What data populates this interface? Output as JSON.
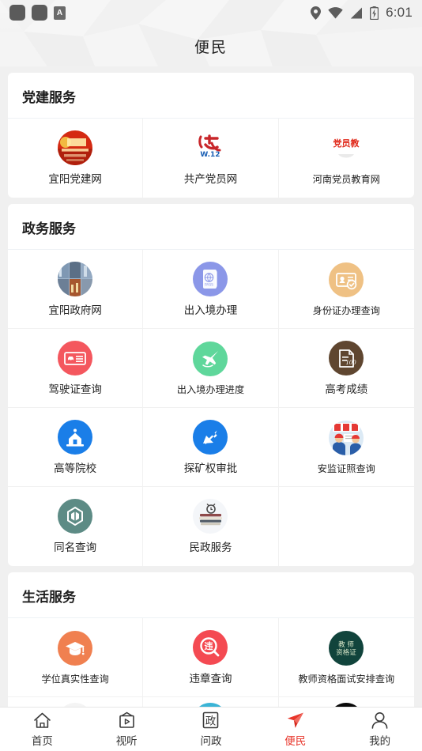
{
  "status_bar": {
    "left_icons": [
      "app-badge-square",
      "app-badge-square",
      "letter-a-badge"
    ],
    "letter_a": "A",
    "right_icons": [
      "location-pin-icon",
      "wifi-icon",
      "signal-icon",
      "battery-charging-icon"
    ],
    "time": "6:01"
  },
  "header": {
    "title": "便民"
  },
  "sections": [
    {
      "title": "党建服务",
      "items": [
        {
          "label": "宜阳党建网",
          "icon": "yiyang-party-logo",
          "color": "#d42a12"
        },
        {
          "label": "共产党员网",
          "icon": "communist-party-member-logo",
          "color": "#c8262a"
        },
        {
          "label": "河南党员教育网",
          "icon": "henan-party-education-logo",
          "color": "#e02718"
        }
      ]
    },
    {
      "title": "政务服务",
      "items": [
        {
          "label": "宜阳政府网",
          "icon": "city-photo-icon",
          "color": "#6d88a8"
        },
        {
          "label": "出入境办理",
          "icon": "passport-icon",
          "color": "#8b97e8"
        },
        {
          "label": "身份证办理查询",
          "icon": "id-card-check-icon",
          "color": "#efc184"
        },
        {
          "label": "驾驶证查询",
          "icon": "driver-license-icon",
          "color": "#f4575e"
        },
        {
          "label": "出入境办理进度",
          "icon": "airplane-icon",
          "color": "#5fd79b"
        },
        {
          "label": "高考成绩",
          "icon": "exam-score-icon",
          "color": "#5f4630"
        },
        {
          "label": "高等院校",
          "icon": "university-icon",
          "color": "#1a7ee8"
        },
        {
          "label": "探矿权审批",
          "icon": "mining-approval-icon",
          "color": "#1a7ee8"
        },
        {
          "label": "安监证照查询",
          "icon": "safety-workers-icon",
          "color": "#4b8fd0"
        },
        {
          "label": "同名查询",
          "icon": "hexagon-shield-icon",
          "color": "#5d8b85"
        },
        {
          "label": "民政服务",
          "icon": "books-clock-icon",
          "color": "#8d6a5e"
        },
        {
          "label": "",
          "icon": "",
          "color": ""
        }
      ]
    },
    {
      "title": "生活服务",
      "items": [
        {
          "label": "学位真实性查询",
          "icon": "graduation-cap-circle-icon",
          "color": "#f08050"
        },
        {
          "label": "违章查询",
          "icon": "violation-search-icon",
          "color": "#f44a52"
        },
        {
          "label": "教师资格面试安排查询",
          "icon": "teacher-certificate-icon",
          "color": "#11443c"
        },
        {
          "label": "",
          "icon": "graduation-cap-photo-icon",
          "color": "#2a2a2a"
        },
        {
          "label": "",
          "icon": "blue-card-icon",
          "color": "#3ab4d6"
        },
        {
          "label": "",
          "icon": "green-leaf-black-logo-icon",
          "color": "#0a0a0a"
        }
      ]
    }
  ],
  "tabbar": {
    "active_color": "#e8352a",
    "items": [
      {
        "label": "首页",
        "icon": "home-icon",
        "active": false
      },
      {
        "label": "视听",
        "icon": "tv-play-icon",
        "active": false
      },
      {
        "label": "问政",
        "icon": "government-box-icon",
        "active": false
      },
      {
        "label": "便民",
        "icon": "paper-plane-icon",
        "active": true
      },
      {
        "label": "我的",
        "icon": "person-icon",
        "active": false
      }
    ]
  }
}
